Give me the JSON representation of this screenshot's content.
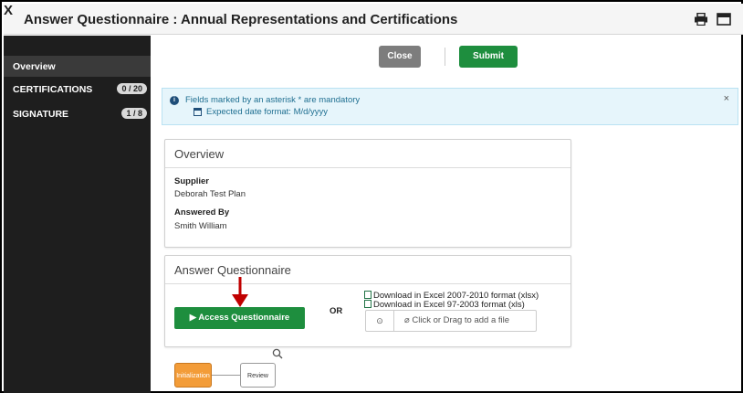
{
  "window": {
    "title": "Answer Questionnaire : Annual Representations and Certifications",
    "close_glyph": "X"
  },
  "sidebar": {
    "items": [
      {
        "label": "Overview",
        "badge": ""
      },
      {
        "label": "CERTIFICATIONS",
        "badge": "0 / 20"
      },
      {
        "label": "SIGNATURE",
        "badge": "1 / 8"
      }
    ]
  },
  "toolbar": {
    "close_label": "Close",
    "submit_label": "Submit"
  },
  "info": {
    "mandatory_text": "Fields marked by an asterisk * are mandatory",
    "date_format_text": "Expected date format: M/d/yyyy",
    "dismiss_glyph": "×"
  },
  "overview": {
    "heading": "Overview",
    "supplier_label": "Supplier",
    "supplier_value": "Deborah Test Plan",
    "answered_by_label": "Answered By",
    "answered_by_value": "Smith William"
  },
  "answer_questionnaire": {
    "heading": "Answer Questionnaire",
    "access_button": "▶ Access Questionnaire",
    "or_text": "OR",
    "download_xlsx": "Download in Excel 2007-2010 format (xlsx)",
    "download_xls": "Download in Excel 97-2003 format (xls)",
    "upload_text": "Click or Drag to add a file"
  },
  "workflow": {
    "steps": [
      "Initialization",
      "Review"
    ]
  },
  "colors": {
    "green": "#1e8e3e",
    "close_gray": "#7d7d7d",
    "sidebar_bg": "#1e1e1e",
    "info_bg": "#e6f5fb",
    "arrow_red": "#c00000",
    "initialization_orange": "#f39c38"
  },
  "icons": [
    "print-icon",
    "window-icon",
    "info-icon",
    "calendar-icon",
    "excel-icon",
    "upload-icon",
    "paperclip-icon",
    "arrow-down-icon",
    "search-icon"
  ]
}
